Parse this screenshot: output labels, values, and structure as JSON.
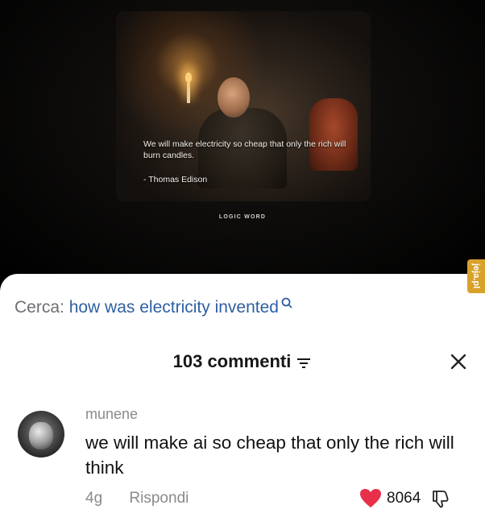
{
  "video": {
    "quote": "We will make electricity so cheap that only the rich will burn candles.",
    "author": "- Thomas Edison",
    "brand": "LOGIC WORD",
    "watermark": "jeja.pl"
  },
  "sheet": {
    "search_label": "Cerca:",
    "search_query": "how was electricity invented",
    "comment_count": "103 commenti",
    "comments": [
      {
        "username": "munene",
        "text": "we will make ai so cheap that only the rich will think",
        "time": "4g",
        "reply_label": "Rispondi",
        "likes": "8064"
      }
    ]
  },
  "colors": {
    "link_blue": "#2f5fa3",
    "heart_red": "#e8304a",
    "watermark_gold": "#d9a12a"
  },
  "icons": [
    "search-icon",
    "sort-icon",
    "close-icon",
    "heart-icon",
    "dislike-icon"
  ]
}
